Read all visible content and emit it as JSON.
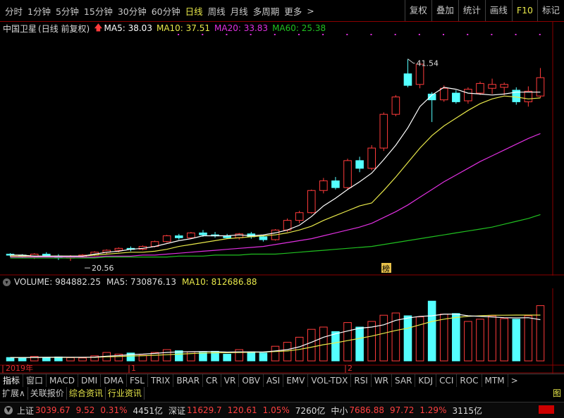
{
  "periods": {
    "items": [
      "分时",
      "1分钟",
      "5分钟",
      "15分钟",
      "30分钟",
      "60分钟",
      "日线",
      "周线",
      "月线",
      "多周期",
      "更多"
    ],
    "more_arrow": ">",
    "active": "日线"
  },
  "toolbar_right": [
    "复权",
    "叠加",
    "统计",
    "画线",
    "F10",
    "标记"
  ],
  "stock": {
    "name": "中国卫星",
    "mode": "(日线 前复权)",
    "ma5": "MA5: 38.03",
    "ma10": "MA10: 37.51",
    "ma20": "MA20: 33.83",
    "ma60": "MA60: 25.38",
    "high_label": "41.54",
    "low_label": "20.56",
    "badge": "榜"
  },
  "volume": {
    "vol": "VOLUME: 984882.25",
    "ma5": "MA5: 730876.13",
    "ma10": "MA10: 812686.88"
  },
  "time_axis": {
    "year": "2019年",
    "m1": "1",
    "m2": "2"
  },
  "indicator_tabs": [
    "指标",
    "窗口",
    "MACD",
    "DMI",
    "DMA",
    "FSL",
    "TRIX",
    "BRAR",
    "CR",
    "VR",
    "OBV",
    "ASI",
    "EMV",
    "VOL-TDX",
    "RSI",
    "WR",
    "SAR",
    "KDJ",
    "CCI",
    "ROC",
    "MTM"
  ],
  "indicator_more": ">",
  "sub_tabs": [
    "扩展∧",
    "关联报价",
    "综合资讯",
    "行业资讯"
  ],
  "sub_tabs_highlight": [
    "综合资讯",
    "行业资讯"
  ],
  "corner_label": "图",
  "market": {
    "sh_name": "上证",
    "sh_val": "3039.67",
    "sh_chg": "9.52",
    "sh_pct": "0.31%",
    "sh_amt": "4451亿",
    "sz_name": "深证",
    "sz_val": "11629.7",
    "sz_chg": "120.61",
    "sz_pct": "1.05%",
    "sz_amt": "7260亿",
    "zx_name": "中小",
    "zx_val": "7686.88",
    "zx_chg": "97.72",
    "zx_pct": "1.29%",
    "zx_amt": "3115亿"
  },
  "colors": {
    "up": "#ff3b3b",
    "down": "#54ffff",
    "ma5": "#ffffff",
    "ma10": "#e8e84a",
    "ma20": "#e030e0",
    "ma60": "#20c020",
    "grid": "#8b0000"
  },
  "chart_data": {
    "type": "candlestick",
    "y_range": [
      19,
      44
    ],
    "volume_range": [
      0,
      1300000
    ],
    "candles": [
      {
        "o": 21.3,
        "h": 21.4,
        "l": 21.0,
        "c": 21.2
      },
      {
        "o": 21.2,
        "h": 21.3,
        "l": 20.9,
        "c": 21.0
      },
      {
        "o": 21.0,
        "h": 21.4,
        "l": 20.8,
        "c": 21.3
      },
      {
        "o": 21.3,
        "h": 21.5,
        "l": 21.0,
        "c": 21.1
      },
      {
        "o": 21.1,
        "h": 21.3,
        "l": 20.7,
        "c": 20.9
      },
      {
        "o": 20.9,
        "h": 21.2,
        "l": 20.6,
        "c": 21.0
      },
      {
        "o": 21.0,
        "h": 21.3,
        "l": 20.9,
        "c": 21.2
      },
      {
        "o": 21.2,
        "h": 21.6,
        "l": 21.1,
        "c": 21.5
      },
      {
        "o": 21.5,
        "h": 21.8,
        "l": 21.3,
        "c": 21.7
      },
      {
        "o": 21.7,
        "h": 22.0,
        "l": 21.5,
        "c": 21.9
      },
      {
        "o": 21.9,
        "h": 22.1,
        "l": 21.6,
        "c": 21.8
      },
      {
        "o": 21.8,
        "h": 22.2,
        "l": 21.7,
        "c": 22.1
      },
      {
        "o": 22.1,
        "h": 22.7,
        "l": 22.0,
        "c": 22.6
      },
      {
        "o": 22.6,
        "h": 23.3,
        "l": 22.5,
        "c": 23.2
      },
      {
        "o": 23.2,
        "h": 23.4,
        "l": 22.8,
        "c": 23.0
      },
      {
        "o": 23.0,
        "h": 23.6,
        "l": 22.9,
        "c": 23.5
      },
      {
        "o": 23.5,
        "h": 23.8,
        "l": 23.1,
        "c": 23.3
      },
      {
        "o": 23.3,
        "h": 23.6,
        "l": 23.0,
        "c": 23.2
      },
      {
        "o": 23.2,
        "h": 23.4,
        "l": 22.9,
        "c": 23.0
      },
      {
        "o": 23.0,
        "h": 23.5,
        "l": 22.8,
        "c": 23.4
      },
      {
        "o": 23.4,
        "h": 23.6,
        "l": 22.9,
        "c": 23.1
      },
      {
        "o": 23.1,
        "h": 23.3,
        "l": 22.6,
        "c": 22.8
      },
      {
        "o": 22.8,
        "h": 23.9,
        "l": 22.7,
        "c": 23.8
      },
      {
        "o": 23.8,
        "h": 25.0,
        "l": 23.6,
        "c": 24.8
      },
      {
        "o": 24.8,
        "h": 25.8,
        "l": 24.5,
        "c": 25.6
      },
      {
        "o": 25.6,
        "h": 28.0,
        "l": 25.5,
        "c": 27.9
      },
      {
        "o": 27.9,
        "h": 29.2,
        "l": 27.6,
        "c": 28.9
      },
      {
        "o": 28.9,
        "h": 29.3,
        "l": 28.0,
        "c": 28.2
      },
      {
        "o": 28.2,
        "h": 31.2,
        "l": 28.0,
        "c": 31.0
      },
      {
        "o": 31.0,
        "h": 31.4,
        "l": 29.8,
        "c": 30.2
      },
      {
        "o": 30.2,
        "h": 32.6,
        "l": 30.0,
        "c": 32.3
      },
      {
        "o": 32.3,
        "h": 36.0,
        "l": 32.0,
        "c": 35.8
      },
      {
        "o": 35.8,
        "h": 37.8,
        "l": 35.6,
        "c": 37.6
      },
      {
        "o": 40.0,
        "h": 41.54,
        "l": 38.6,
        "c": 38.8
      },
      {
        "o": 38.9,
        "h": 41.2,
        "l": 38.5,
        "c": 41.0
      },
      {
        "o": 37.9,
        "h": 38.1,
        "l": 35.0,
        "c": 37.3
      },
      {
        "o": 37.3,
        "h": 38.8,
        "l": 37.1,
        "c": 38.5
      },
      {
        "o": 38.0,
        "h": 38.3,
        "l": 36.9,
        "c": 37.1
      },
      {
        "o": 37.2,
        "h": 38.6,
        "l": 36.9,
        "c": 38.4
      },
      {
        "o": 38.0,
        "h": 39.2,
        "l": 37.8,
        "c": 39.0
      },
      {
        "o": 38.5,
        "h": 39.5,
        "l": 37.9,
        "c": 38.9
      },
      {
        "o": 38.6,
        "h": 39.1,
        "l": 37.8,
        "c": 38.9
      },
      {
        "o": 38.3,
        "h": 38.6,
        "l": 36.8,
        "c": 37.1
      },
      {
        "o": 37.1,
        "h": 38.7,
        "l": 36.6,
        "c": 38.2
      },
      {
        "o": 37.7,
        "h": 40.6,
        "l": 37.5,
        "c": 39.6
      }
    ],
    "volumes": [
      60000,
      55000,
      80000,
      62000,
      70000,
      58000,
      52000,
      90000,
      150000,
      120000,
      140000,
      100000,
      150000,
      200000,
      180000,
      160000,
      150000,
      170000,
      120000,
      200000,
      160000,
      140000,
      260000,
      330000,
      420000,
      560000,
      600000,
      520000,
      680000,
      600000,
      700000,
      810000,
      850000,
      800000,
      780000,
      1060000,
      830000,
      840000,
      700000,
      740000,
      800000,
      750000,
      740000,
      800000,
      980000
    ],
    "ma5": [
      21.2,
      21.2,
      21.1,
      21.1,
      21.1,
      21.1,
      21.1,
      21.3,
      21.5,
      21.6,
      21.8,
      21.9,
      22.1,
      22.4,
      22.7,
      22.9,
      23.2,
      23.2,
      23.2,
      23.3,
      23.2,
      23.3,
      23.5,
      23.8,
      24.3,
      25.2,
      26.3,
      27.1,
      28.0,
      28.8,
      29.7,
      31.1,
      32.6,
      34.4,
      36.6,
      37.8,
      38.6,
      38.4,
      38.0,
      37.9,
      37.8,
      37.9,
      38.1,
      38.1,
      38.1
    ],
    "ma10": [
      21.1,
      21.1,
      21.1,
      21.1,
      21.1,
      21.1,
      21.1,
      21.2,
      21.3,
      21.4,
      21.5,
      21.5,
      21.6,
      21.8,
      22.1,
      22.3,
      22.5,
      22.7,
      22.9,
      23.0,
      23.1,
      23.2,
      23.3,
      23.5,
      23.8,
      24.2,
      24.8,
      25.3,
      25.8,
      26.3,
      26.6,
      27.9,
      29.3,
      30.8,
      32.3,
      33.6,
      34.6,
      35.4,
      36.2,
      36.9,
      37.4,
      37.7,
      37.6,
      37.4,
      37.5
    ],
    "ma20": [
      21.0,
      21.0,
      21.0,
      21.0,
      21.0,
      21.0,
      21.0,
      21.0,
      21.1,
      21.1,
      21.1,
      21.2,
      21.2,
      21.3,
      21.4,
      21.5,
      21.6,
      21.7,
      21.8,
      21.9,
      22.0,
      22.1,
      22.3,
      22.5,
      22.7,
      22.9,
      23.2,
      23.5,
      23.8,
      24.1,
      24.5,
      25.1,
      25.7,
      26.4,
      27.2,
      28.0,
      28.8,
      29.5,
      30.2,
      30.9,
      31.5,
      32.1,
      32.7,
      33.3,
      33.8
    ],
    "ma60": [
      20.9,
      20.9,
      20.9,
      20.9,
      20.9,
      20.9,
      20.9,
      20.9,
      21.0,
      21.0,
      21.0,
      21.0,
      21.0,
      21.0,
      21.1,
      21.1,
      21.1,
      21.2,
      21.2,
      21.2,
      21.3,
      21.3,
      21.3,
      21.4,
      21.5,
      21.6,
      21.7,
      21.8,
      21.9,
      22.0,
      22.1,
      22.3,
      22.5,
      22.7,
      22.9,
      23.1,
      23.3,
      23.5,
      23.7,
      23.9,
      24.1,
      24.4,
      24.7,
      25.0,
      25.4
    ],
    "vol_ma5": [
      60000,
      60000,
      62000,
      64000,
      66000,
      65000,
      64000,
      68000,
      84000,
      94000,
      112000,
      120000,
      132000,
      150000,
      160000,
      162000,
      168000,
      166000,
      156000,
      160000,
      160000,
      158000,
      178000,
      200000,
      250000,
      330000,
      420000,
      480000,
      530000,
      580000,
      600000,
      640000,
      720000,
      760000,
      790000,
      800000,
      830000,
      830000,
      800000,
      790000,
      780000,
      766000,
      762000,
      766000,
      730876
    ],
    "vol_ma10": [
      60000,
      60000,
      61000,
      62000,
      63000,
      63000,
      62000,
      64000,
      72000,
      78000,
      88000,
      92000,
      100000,
      110000,
      120000,
      130000,
      140000,
      144000,
      146000,
      150000,
      152000,
      156000,
      166000,
      176000,
      204000,
      244000,
      288000,
      320000,
      360000,
      400000,
      440000,
      490000,
      540000,
      580000,
      640000,
      700000,
      740000,
      770000,
      790000,
      800000,
      810000,
      810000,
      812000,
      812000,
      812686
    ]
  }
}
